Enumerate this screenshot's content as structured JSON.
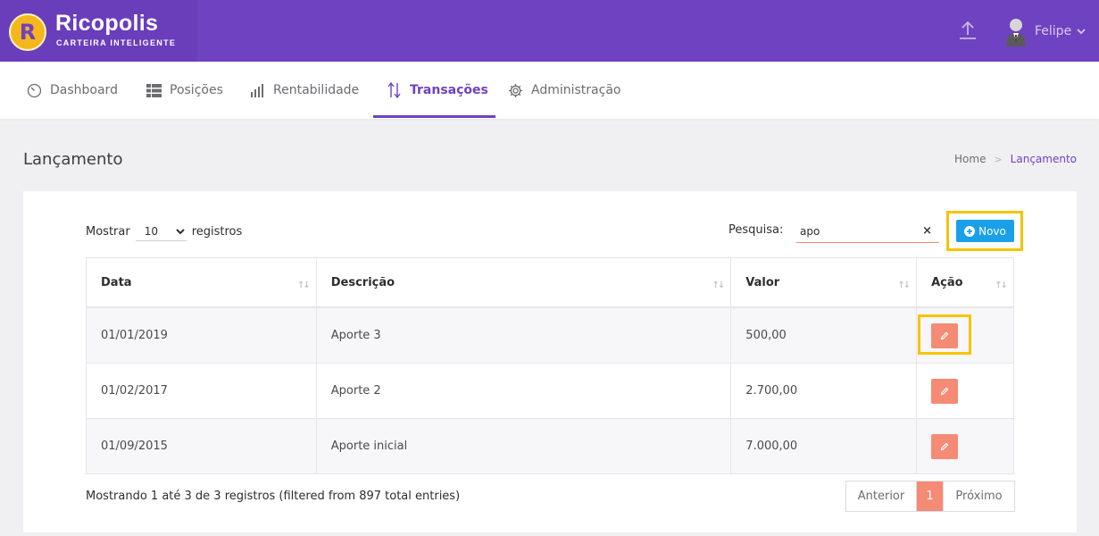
{
  "brand": {
    "initial": "R",
    "name": "Ricopolis",
    "tagline": "CARTEIRA INTELIGENTE"
  },
  "user": {
    "name": "Felipe"
  },
  "nav": {
    "items": [
      {
        "label": "Dashboard",
        "icon": "dashboard-gauge-icon",
        "active": false
      },
      {
        "label": "Posições",
        "icon": "table-list-icon",
        "active": false
      },
      {
        "label": "Rentabilidade",
        "icon": "bar-chart-icon",
        "active": false
      },
      {
        "label": "Transações",
        "icon": "transfer-arrows-icon",
        "active": true
      },
      {
        "label": "Administração",
        "icon": "gear-icon",
        "active": false
      }
    ]
  },
  "page": {
    "title": "Lançamento"
  },
  "breadcrumb": {
    "home": "Home",
    "separator": ">",
    "current": "Lançamento"
  },
  "controls": {
    "show_label": "Mostrar",
    "page_size": "10",
    "records_label": "registros",
    "search_label": "Pesquisa:",
    "search_value": "apo",
    "clear_label": "×",
    "new_button": "Novo"
  },
  "table": {
    "columns": [
      "Data",
      "Descrição",
      "Valor",
      "Ação"
    ],
    "rows": [
      {
        "data": "01/01/2019",
        "descricao": "Aporte 3",
        "valor": "500,00"
      },
      {
        "data": "01/02/2017",
        "descricao": "Aporte 2",
        "valor": "2.700,00"
      },
      {
        "data": "01/09/2015",
        "descricao": "Aporte inicial",
        "valor": "7.000,00"
      }
    ]
  },
  "footer": {
    "info": "Mostrando 1 até 3 de 3 registros (filtered from 897 total entries)",
    "prev": "Anterior",
    "current_page": "1",
    "next": "Próximo"
  },
  "colors": {
    "primary": "#6f42c1",
    "accent": "#f58b74",
    "button_blue": "#1aa0e8",
    "highlight": "#f5c400"
  }
}
